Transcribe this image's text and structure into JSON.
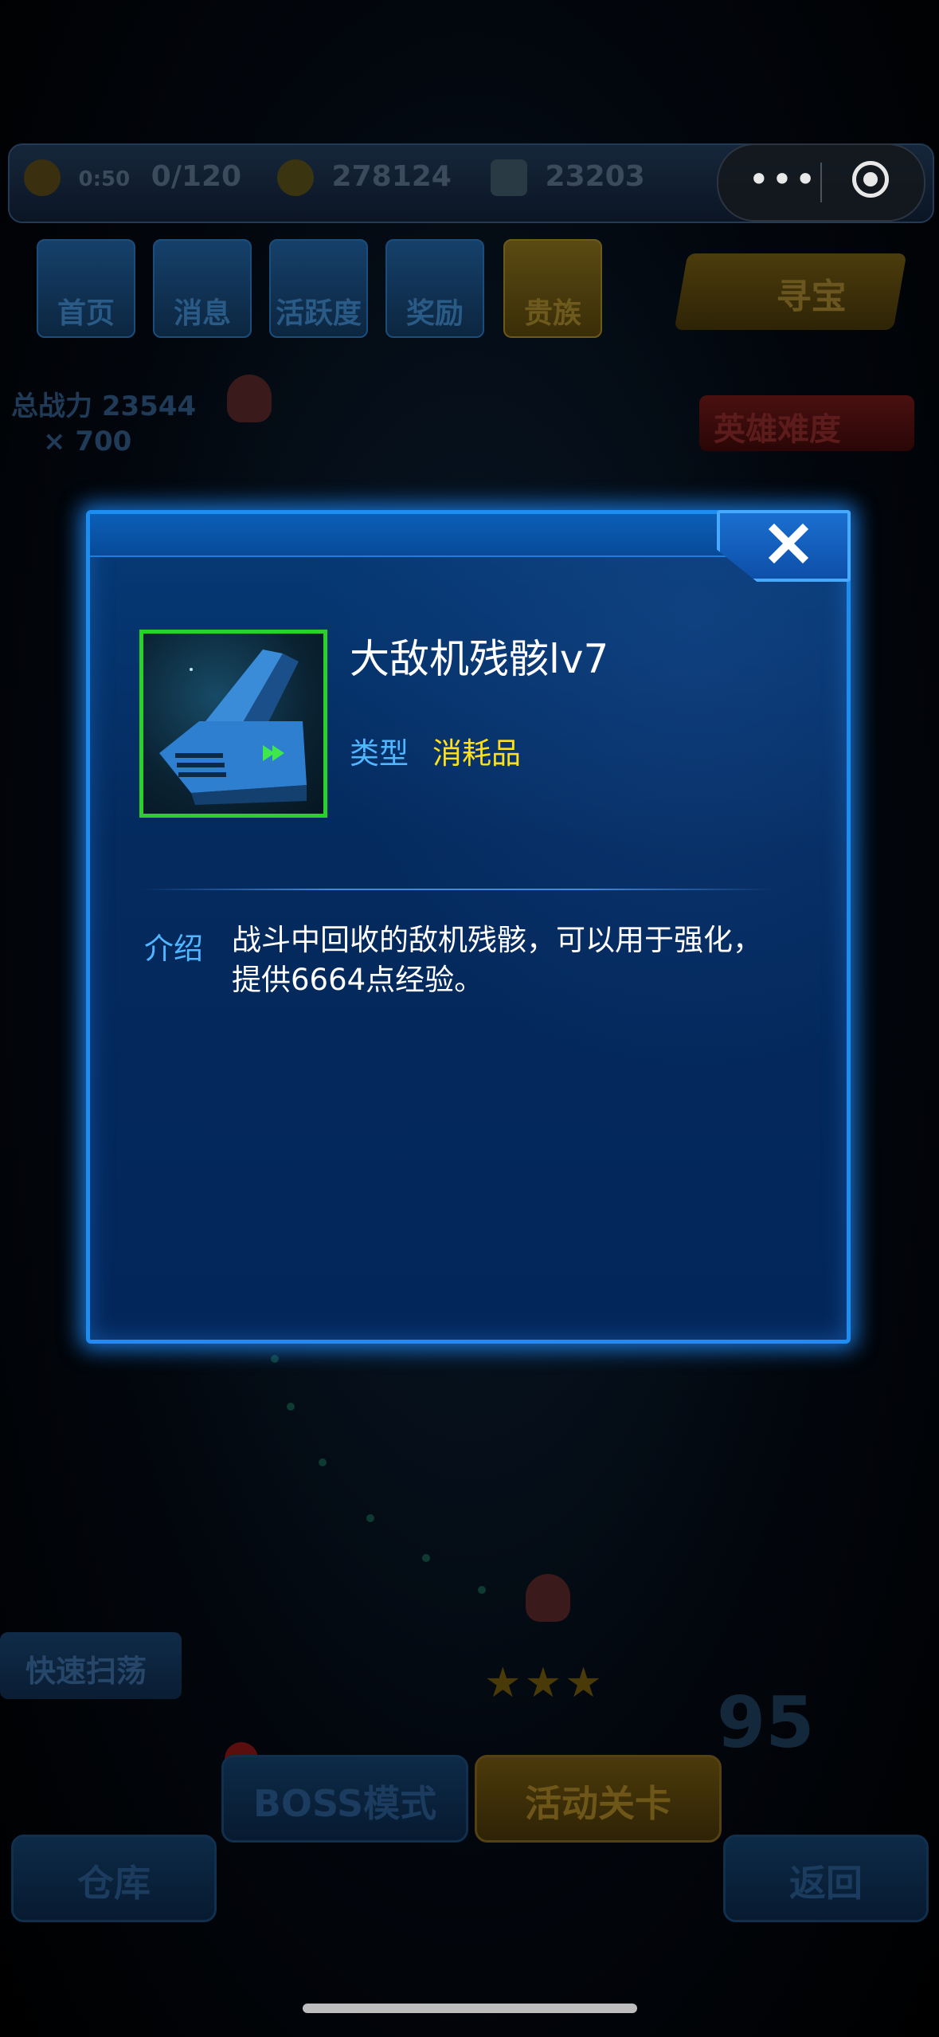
{
  "top_bar": {
    "energy_timer": "0:50",
    "energy": "0/120",
    "gold": "278124",
    "diamonds": "23203"
  },
  "nav": [
    {
      "label": "首页"
    },
    {
      "label": "消息"
    },
    {
      "label": "活跃度"
    },
    {
      "label": "奖励"
    },
    {
      "label": "贵族"
    }
  ],
  "treasure_label": "寻宝",
  "stats": {
    "power": "总战力 23544",
    "keys": "× 700"
  },
  "hero_badge": "英雄难度",
  "quick_sweep": "快速扫荡",
  "stage_number": "95",
  "bottom": {
    "boss_mode": "BOSS模式",
    "event_stage": "活动关卡",
    "warehouse": "仓库",
    "back": "返回"
  },
  "modal": {
    "item_name": "大敌机残骸lv7",
    "type_label": "类型",
    "type_value": "消耗品",
    "intro_label": "介绍",
    "intro_text": "战斗中回收的敌机残骸，可以用于强化，提供6664点经验。",
    "rarity_color": "#2bd12b"
  }
}
